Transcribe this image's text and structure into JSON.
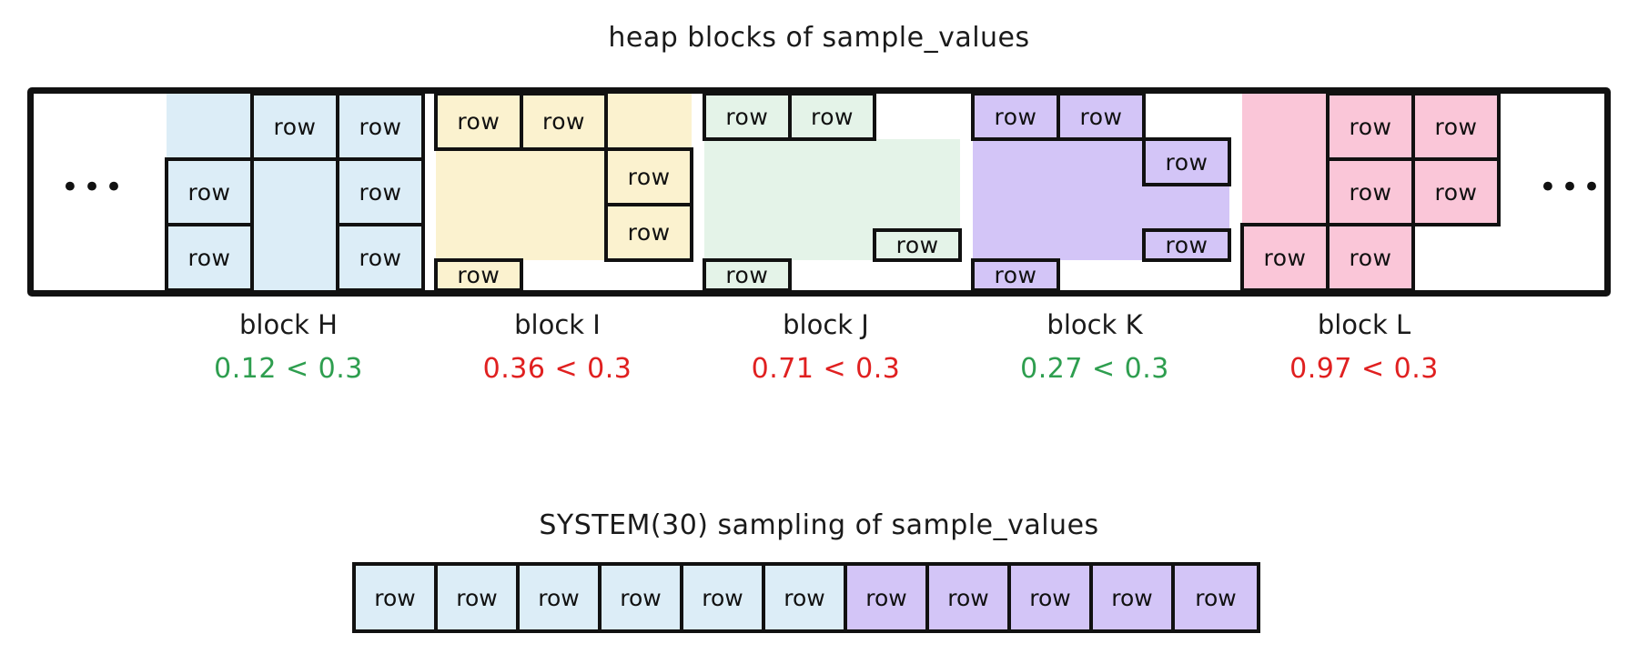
{
  "heap": {
    "title": "heap blocks of sample_values",
    "leading_ellipsis": "•••",
    "trailing_ellipsis": "•••",
    "row_label": "row",
    "colors": {
      "block_H": "#dcedf7",
      "block_I": "#fbf2cf",
      "block_J": "#e4f3e8",
      "block_K": "#d3c5f7",
      "block_L": "#fac6d8",
      "outline": "#111111",
      "pass": "#2e9e4f",
      "fail": "#e02020"
    },
    "blocks": [
      {
        "id": "H",
        "name": "block H",
        "color": "#dcedf7",
        "threshold": "0.3",
        "value": "0.12",
        "comparison": "0.12 < 0.3",
        "status": "pass",
        "cells": [
          {
            "label": "",
            "span": "1x1"
          },
          {
            "label": "row",
            "span": "1x1"
          },
          {
            "label": "row",
            "span": "1x1"
          },
          {
            "label": "row",
            "span": "1x1"
          },
          {
            "label": "",
            "span": "2x1"
          },
          {
            "label": "row",
            "span": "1x1"
          },
          {
            "label": "row",
            "span": "1x1"
          },
          {
            "label": "row",
            "span": "1x1"
          }
        ]
      },
      {
        "id": "I",
        "name": "block I",
        "color": "#fbf2cf",
        "threshold": "0.3",
        "value": "0.36",
        "comparison": "0.36 < 0.3",
        "status": "fail",
        "cells": [
          {
            "label": "row",
            "span": "1x1"
          },
          {
            "label": "row",
            "span": "1x1"
          },
          {
            "label": "",
            "span": "1x1"
          },
          {
            "label": "",
            "span": "2x2"
          },
          {
            "label": "row",
            "span": "1x1"
          },
          {
            "label": "row",
            "span": "1x1"
          },
          {
            "label": "row",
            "span": "1x1"
          }
        ]
      },
      {
        "id": "J",
        "name": "block J",
        "color": "#e4f3e8",
        "threshold": "0.3",
        "value": "0.71",
        "comparison": "0.71 < 0.3",
        "status": "fail",
        "cells": [
          {
            "label": "row",
            "span": "1x1"
          },
          {
            "label": "row",
            "span": "1x1"
          },
          {
            "label": "",
            "span": "1x3"
          },
          {
            "label": "",
            "span": "2x1"
          },
          {
            "label": "row",
            "span": "1x1"
          },
          {
            "label": "row",
            "span": "1x1"
          }
        ]
      },
      {
        "id": "K",
        "name": "block K",
        "color": "#d3c5f7",
        "threshold": "0.3",
        "value": "0.27",
        "comparison": "0.27 < 0.3",
        "status": "pass",
        "cells": [
          {
            "label": "row",
            "span": "1x1"
          },
          {
            "label": "row",
            "span": "1x1"
          },
          {
            "label": "",
            "span": "1x3"
          },
          {
            "label": "row",
            "span": "1x1"
          },
          {
            "label": "",
            "span": "1x1"
          },
          {
            "label": "row",
            "span": "1x1"
          },
          {
            "label": "row",
            "span": "1x1"
          }
        ]
      },
      {
        "id": "L",
        "name": "block L",
        "color": "#fac6d8",
        "threshold": "0.3",
        "value": "0.97",
        "comparison": "0.97 < 0.3",
        "status": "fail",
        "cells": [
          {
            "label": "",
            "span": "2x1"
          },
          {
            "label": "row",
            "span": "1x1"
          },
          {
            "label": "row",
            "span": "1x1"
          },
          {
            "label": "row",
            "span": "1x1"
          },
          {
            "label": "row",
            "span": "1x1"
          },
          {
            "label": "row",
            "span": "1x1"
          },
          {
            "label": "row",
            "span": "1x1"
          }
        ]
      }
    ]
  },
  "sample": {
    "title": "SYSTEM(30) sampling of sample_values",
    "rows": [
      {
        "label": "row",
        "color": "#dcedf7",
        "from_block": "H"
      },
      {
        "label": "row",
        "color": "#dcedf7",
        "from_block": "H"
      },
      {
        "label": "row",
        "color": "#dcedf7",
        "from_block": "H"
      },
      {
        "label": "row",
        "color": "#dcedf7",
        "from_block": "H"
      },
      {
        "label": "row",
        "color": "#dcedf7",
        "from_block": "H"
      },
      {
        "label": "row",
        "color": "#dcedf7",
        "from_block": "H"
      },
      {
        "label": "row",
        "color": "#d3c5f7",
        "from_block": "K"
      },
      {
        "label": "row",
        "color": "#d3c5f7",
        "from_block": "K"
      },
      {
        "label": "row",
        "color": "#d3c5f7",
        "from_block": "K"
      },
      {
        "label": "row",
        "color": "#d3c5f7",
        "from_block": "K"
      },
      {
        "label": "row",
        "color": "#d3c5f7",
        "from_block": "K"
      }
    ]
  }
}
